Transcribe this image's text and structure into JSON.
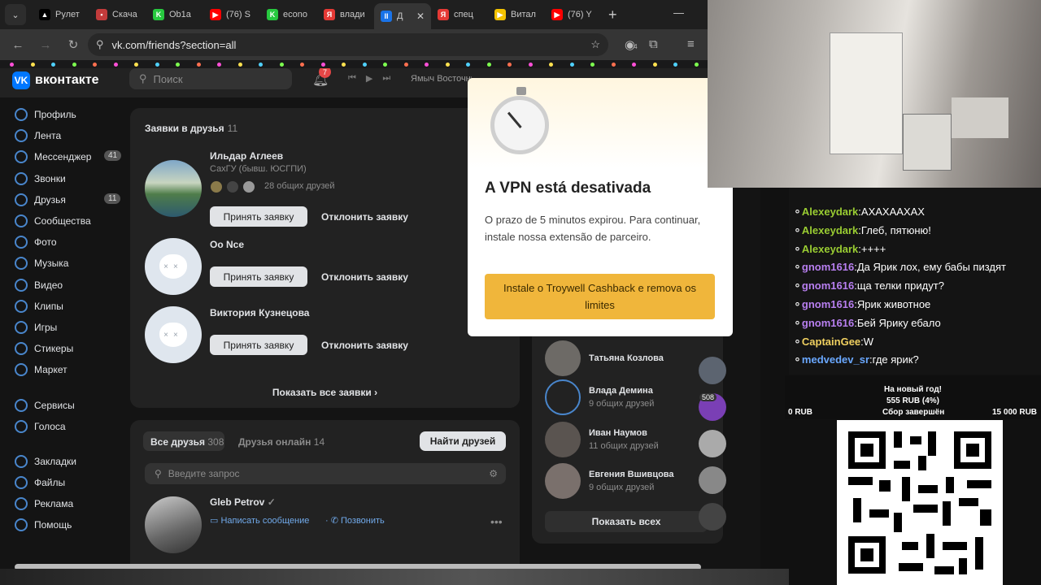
{
  "browser": {
    "tabs": [
      {
        "label": "Рулет",
        "fav": "▲",
        "color": "#000000"
      },
      {
        "label": "Скача",
        "fav": "▪",
        "color": "#c23b3b"
      },
      {
        "label": "Ob1a",
        "fav": "K",
        "color": "#27c93f"
      },
      {
        "label": "(76) S",
        "fav": "▶",
        "color": "#ff0000"
      },
      {
        "label": "econo",
        "fav": "K",
        "color": "#27c93f"
      },
      {
        "label": "влади",
        "fav": "Я",
        "color": "#e53935"
      },
      {
        "label": "Д",
        "fav": "II",
        "color": "#1a73e8"
      },
      {
        "label": "спец",
        "fav": "Я",
        "color": "#e53935"
      },
      {
        "label": "Витал",
        "fav": "▶",
        "color": "#f2c200"
      },
      {
        "label": "(76) Y",
        "fav": "▶",
        "color": "#ff0000"
      }
    ],
    "url": "vk.com/friends?section=all",
    "ext_badge": "4"
  },
  "vk": {
    "brand": "вконтакте",
    "search_placeholder": "Поиск",
    "notif_count": "7",
    "track": "Ямыч Восточный Округ, SUMUS – С",
    "sidebar": [
      {
        "label": "Профиль"
      },
      {
        "label": "Лента"
      },
      {
        "label": "Мессенджер",
        "count": "41"
      },
      {
        "label": "Звонки"
      },
      {
        "label": "Друзья",
        "count": "11"
      },
      {
        "label": "Сообщества"
      },
      {
        "label": "Фото"
      },
      {
        "label": "Музыка"
      },
      {
        "label": "Видео"
      },
      {
        "label": "Клипы"
      },
      {
        "label": "Игры"
      },
      {
        "label": "Стикеры"
      },
      {
        "label": "Маркет"
      }
    ],
    "sidebar2": [
      {
        "label": "Сервисы"
      },
      {
        "label": "Голоса"
      }
    ],
    "sidebar3": [
      {
        "label": "Закладки"
      },
      {
        "label": "Файлы"
      },
      {
        "label": "Реклама"
      },
      {
        "label": "Помощь"
      }
    ],
    "requests": {
      "title": "Заявки в друзья",
      "count": "11",
      "items": [
        {
          "name": "Ильдар Аглеев",
          "sub": "СахГУ (бывш. ЮСГПИ)",
          "mutual": "28 общих друзей"
        },
        {
          "name": "Oo Nce"
        },
        {
          "name": "Виктория Кузнецова"
        }
      ],
      "accept": "Принять заявку",
      "decline": "Отклонить заявку",
      "show_all": "Показать все заявки"
    },
    "friends": {
      "tab_all": "Все друзья",
      "all_count": "308",
      "tab_online": "Друзья онлайн",
      "online_count": "14",
      "find": "Найти друзей",
      "search_placeholder": "Введите запрос",
      "first": {
        "name": "Gleb Petrov",
        "msg": "Написать сообщение",
        "call": "Позвонить"
      }
    },
    "right": {
      "items": [
        {
          "name": "Татьяна Козлова",
          "sub": ""
        },
        {
          "name": "Влада Демина",
          "sub": "9 общих друзей"
        },
        {
          "name": "Иван Наумов",
          "sub": "11 общих друзей"
        },
        {
          "name": "Евгения Вшивцова",
          "sub": "9 общих друзей"
        }
      ],
      "show": "Показать всех",
      "badge": "508"
    }
  },
  "vpn": {
    "title": "A VPN está desativada",
    "text": "O prazo de 5 minutos expirou. Para continuar, instale nossa extensão de parceiro.",
    "button": "Instale o Troywell Cashback e remova os limites"
  },
  "chat": [
    {
      "user": "Alexeydark",
      "msg": "АХАХААХАХ",
      "color": "#9acd32"
    },
    {
      "user": "Alexeydark",
      "msg": "Глеб, пятюню!",
      "color": "#9acd32"
    },
    {
      "user": "Alexeydark",
      "msg": "++++",
      "color": "#9acd32"
    },
    {
      "user": "gnom1616",
      "msg": "Да Ярик лох, ему бабы пиздят",
      "color": "#b87ff0"
    },
    {
      "user": "gnom1616",
      "msg": "ща телки придут?",
      "color": "#b87ff0"
    },
    {
      "user": "gnom1616",
      "msg": "Ярик животное",
      "color": "#b87ff0"
    },
    {
      "user": "gnom1616",
      "msg": "Бей Ярику ебало",
      "color": "#b87ff0"
    },
    {
      "user": "CaptainGee",
      "msg": "W",
      "color": "#f0d060"
    },
    {
      "user": "medvedev_sr",
      "msg": "где ярик?",
      "color": "#6aa8ff"
    }
  ],
  "donation": {
    "title": "На новый год!",
    "amount": "555 RUB (4%)",
    "min": "0 RUB",
    "status": "Сбор завершён",
    "max": "15 000 RUB"
  }
}
